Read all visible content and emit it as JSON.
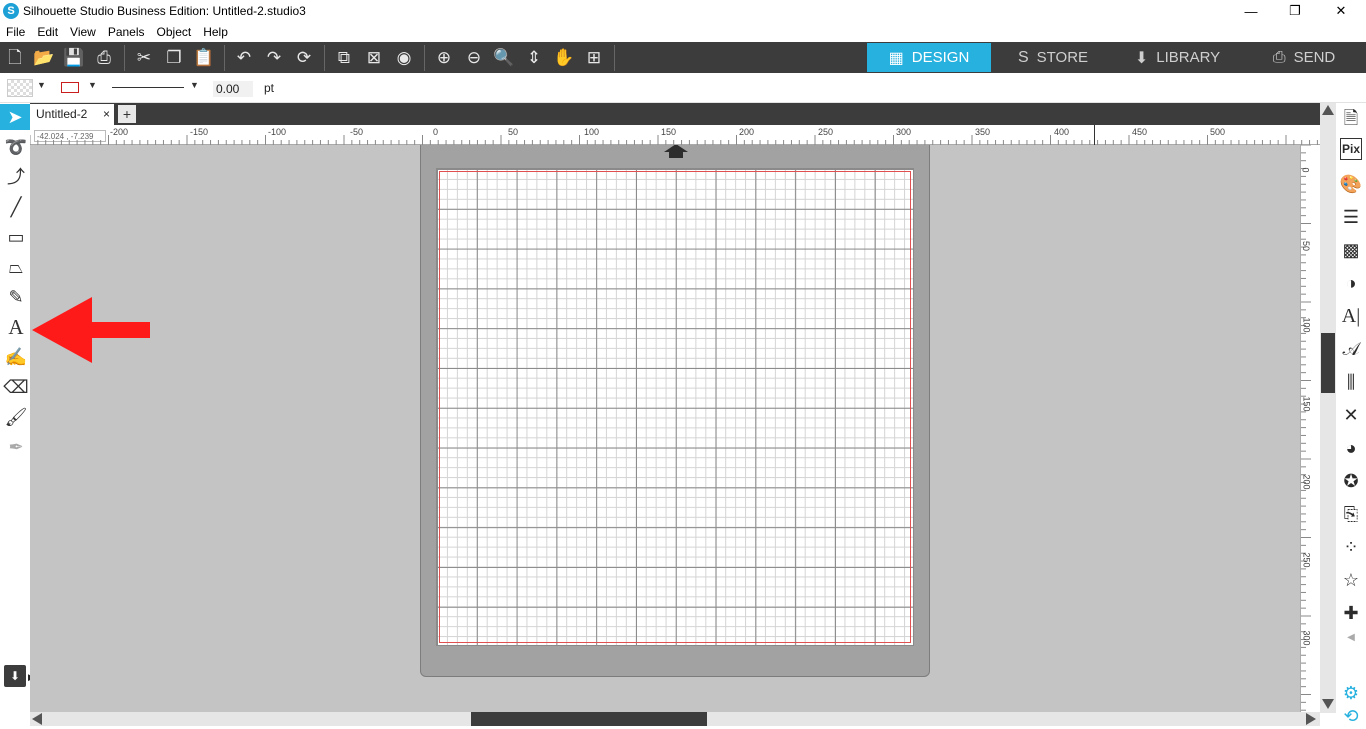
{
  "window": {
    "title": "Silhouette Studio Business Edition: Untitled-2.studio3",
    "app_icon_letter": "S",
    "minimize": "—",
    "maximize": "❐",
    "close": "✕"
  },
  "menu": [
    "File",
    "Edit",
    "View",
    "Panels",
    "Object",
    "Help"
  ],
  "nav_tabs": [
    {
      "label": "DESIGN",
      "icon": "grid-icon",
      "active": true
    },
    {
      "label": "STORE",
      "icon": "store-icon",
      "active": false
    },
    {
      "label": "LIBRARY",
      "icon": "library-icon",
      "active": false
    },
    {
      "label": "SEND",
      "icon": "send-icon",
      "active": false
    }
  ],
  "properties": {
    "line_width_value": "0.00",
    "line_width_unit": "pt"
  },
  "document_tab": {
    "name": "Untitled-2",
    "close": "×",
    "add": "+"
  },
  "cursor_coords": "-42.024 , -7.239",
  "ruler": {
    "h_labels": [
      "-200",
      "-150",
      "-100",
      "-50",
      "0",
      "50",
      "100",
      "150",
      "200",
      "250",
      "300",
      "350",
      "400",
      "450",
      "500"
    ],
    "v_labels": [
      "0",
      "50",
      "100",
      "150",
      "200",
      "250",
      "300"
    ]
  },
  "colors": {
    "accent": "#27b1df",
    "toolbar_bg": "#3c3c3c",
    "canvas_bg": "#c4c4c4",
    "mat": "#a2a2a2",
    "annotation_arrow": "#ff1a1a"
  }
}
